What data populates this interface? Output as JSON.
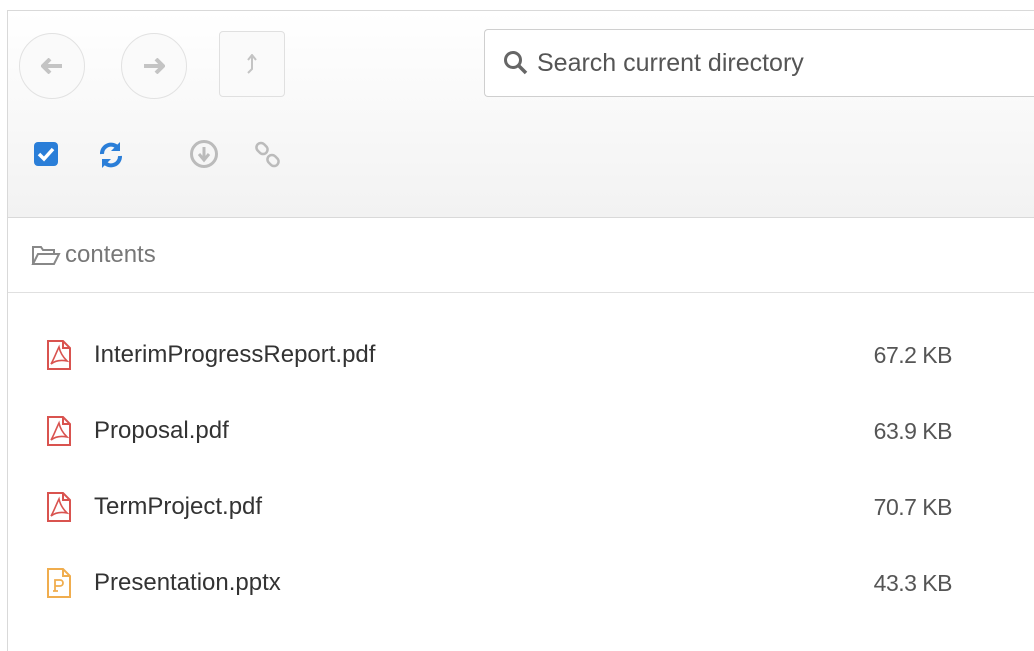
{
  "search": {
    "placeholder": "Search current directory"
  },
  "breadcrumb": {
    "folder_label": "contents"
  },
  "files": [
    {
      "name": "InterimProgressReport.pdf",
      "size": "67.2 KB",
      "type_icon": "pdf-file-icon",
      "color": "#d9534f"
    },
    {
      "name": "Proposal.pdf",
      "size": "63.9 KB",
      "type_icon": "pdf-file-icon",
      "color": "#d9534f"
    },
    {
      "name": "TermProject.pdf",
      "size": "70.7 KB",
      "type_icon": "pdf-file-icon",
      "color": "#d9534f"
    },
    {
      "name": "Presentation.pptx",
      "size": "43.3 KB",
      "type_icon": "powerpoint-file-icon",
      "color": "#f0ad4e"
    }
  ],
  "colors": {
    "accent": "#2a7ed8",
    "muted_icon": "#bbbbbb"
  }
}
